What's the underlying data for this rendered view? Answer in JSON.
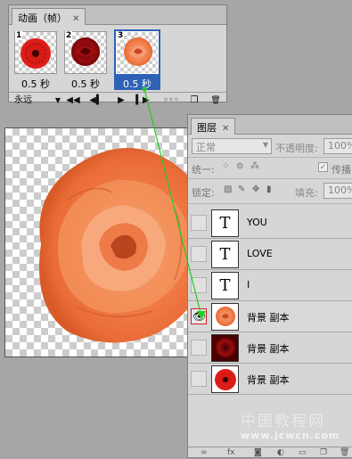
{
  "animation_panel": {
    "tab_label": "动画（帧）",
    "close_glyph": "✕",
    "frames": [
      {
        "number": "1",
        "delay": "0.5 秒",
        "selected": false
      },
      {
        "number": "2",
        "delay": "0.5 秒",
        "selected": false
      },
      {
        "number": "3",
        "delay": "0.5 秒",
        "selected": true
      }
    ],
    "loop_value": "永远",
    "controls": {
      "first": "◀◀",
      "prev": "◀▍",
      "play": "▶",
      "next": "▍▶",
      "tween": "◦◦◦",
      "duplicate": "❐",
      "delete": "🗑"
    }
  },
  "layers_panel": {
    "tab_label": "图层",
    "close_glyph": "✕",
    "blend_mode": "正常",
    "opacity_label": "不透明度:",
    "opacity_value": "100%",
    "unify_label": "统一:",
    "propagate_label": "传播",
    "propagate_checked": true,
    "lock_label": "锁定:",
    "fill_label": "填充:",
    "fill_value": "100%",
    "layers": [
      {
        "name": "YOU",
        "kind": "text",
        "thumb_glyph": "T",
        "visible": false,
        "active": false
      },
      {
        "name": "LOVE",
        "kind": "text",
        "thumb_glyph": "T",
        "visible": false,
        "active": false
      },
      {
        "name": "I",
        "kind": "text",
        "thumb_glyph": "T",
        "visible": false,
        "active": false
      },
      {
        "name": "背景 副本",
        "kind": "image-orange-rose",
        "visible": true,
        "active": true
      },
      {
        "name": "背景 副本",
        "kind": "image-red-rose",
        "visible": false,
        "active": false
      },
      {
        "name": "背景 副本",
        "kind": "image-red-gerbera",
        "visible": false,
        "active": false
      }
    ]
  },
  "watermark": {
    "line1": "中国教程网",
    "line2": "www.jcwcn.com"
  },
  "colors": {
    "selected_frame": "#2e62b6",
    "link_arrow": "#22cc22",
    "visibility_highlight": "#cc2222",
    "rose_orange": "#f07a45"
  }
}
